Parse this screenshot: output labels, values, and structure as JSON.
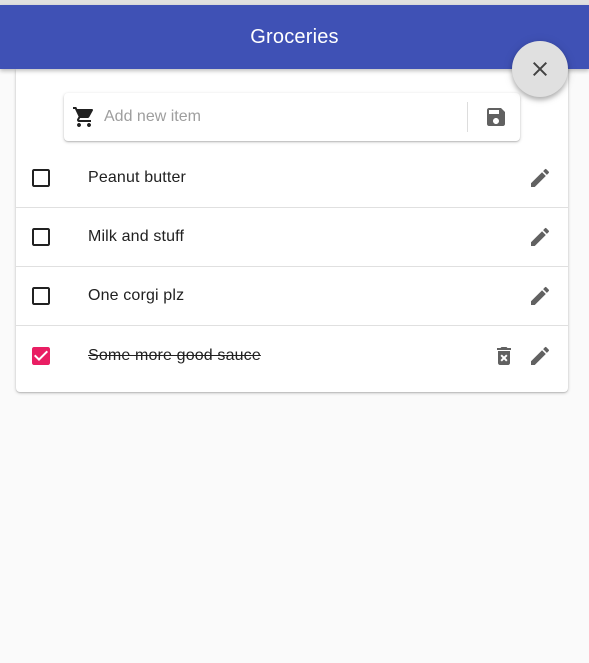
{
  "appbar": {
    "title": "Groceries",
    "color": "#3f51b5"
  },
  "fab": {
    "icon": "close-icon"
  },
  "add_item": {
    "placeholder": "Add new item",
    "value": "",
    "leading_icon": "shopping-cart-icon",
    "save_icon": "save-icon"
  },
  "items": [
    {
      "label": "Peanut butter",
      "checked": false
    },
    {
      "label": "Milk and stuff",
      "checked": false
    },
    {
      "label": "One corgi plz",
      "checked": false
    },
    {
      "label": "Some more good sauce",
      "checked": true
    }
  ],
  "colors": {
    "accent": "#e91e63",
    "icon": "#616161"
  }
}
